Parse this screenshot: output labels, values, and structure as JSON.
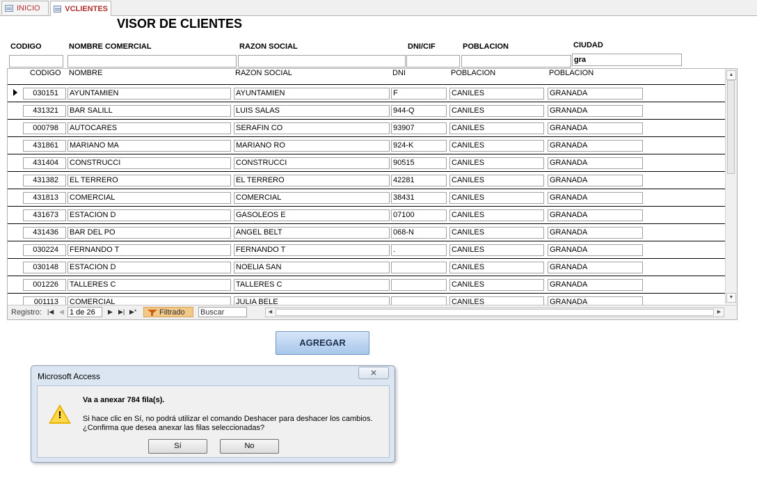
{
  "tabs": [
    {
      "label": "INICIO",
      "icon": "form-icon",
      "active": false
    },
    {
      "label": "VCLIENTES",
      "icon": "form-icon",
      "active": true
    }
  ],
  "page_title": "VISOR DE CLIENTES",
  "filters": {
    "codigo": {
      "label": "CODIGO",
      "value": ""
    },
    "nombre_comercial": {
      "label": "NOMBRE COMERCIAL",
      "value": ""
    },
    "razon_social": {
      "label": "RAZON SOCIAL",
      "value": ""
    },
    "dni_cif": {
      "label": "DNI/CIF",
      "value": ""
    },
    "poblacion": {
      "label": "POBLACION",
      "value": ""
    },
    "ciudad": {
      "label": "CIUDAD",
      "value": "gra"
    }
  },
  "grid": {
    "columns": [
      "CODIGO",
      "NOMBRE",
      "RAZON SOCIAL",
      "DNI",
      "POBLACION",
      "POBLACION"
    ],
    "rows": [
      [
        "030151",
        "AYUNTAMIEN",
        "AYUNTAMIEN",
        "F",
        "CANILES",
        "GRANADA"
      ],
      [
        "431321",
        "BAR SALILL",
        "LUIS SALAS",
        "944-Q",
        "CANILES",
        "GRANADA"
      ],
      [
        "000798",
        "AUTOCARES",
        "SERAFIN CO",
        "93907",
        "CANILES",
        "GRANADA"
      ],
      [
        "431861",
        "MARIANO MA",
        "MARIANO RO",
        "924-K",
        "CANILES",
        "GRANADA"
      ],
      [
        "431404",
        "CONSTRUCCI",
        "CONSTRUCCI",
        "90515",
        "CANILES",
        "GRANADA"
      ],
      [
        "431382",
        "EL TERRERO",
        "EL TERRERO",
        "42281",
        "CANILES",
        "GRANADA"
      ],
      [
        "431813",
        "COMERCIAL",
        "COMERCIAL",
        "38431",
        "CANILES",
        "GRANADA"
      ],
      [
        "431673",
        "ESTACION D",
        "GASOLEOS E",
        "07100",
        "CANILES",
        "GRANADA"
      ],
      [
        "431436",
        "BAR DEL PO",
        "ANGEL BELT",
        "068-N",
        "CANILES",
        "GRANADA"
      ],
      [
        "030224",
        "FERNANDO T",
        "FERNANDO T",
        ".",
        "CANILES",
        "GRANADA"
      ],
      [
        "030148",
        "ESTACION D",
        "NOELIA SAN",
        "",
        "CANILES",
        "GRANADA"
      ],
      [
        "001226",
        "TALLERES C",
        "TALLERES C",
        "",
        "CANILES",
        "GRANADA"
      ],
      [
        "001113",
        "COMERCIAL",
        "JULIA BELE",
        "",
        "CANILES",
        "GRANADA"
      ]
    ]
  },
  "navigator": {
    "label": "Registro:",
    "record": "1 de 26",
    "filter_label": "Filtrado",
    "search_placeholder": "Buscar"
  },
  "add_button": "AGREGAR",
  "dialog": {
    "title": "Microsoft Access",
    "close": "✕",
    "heading": "Va a anexar 784 fila(s).",
    "line1": "Si hace clic en Sí, no podrá utilizar el comando Deshacer para deshacer los cambios.",
    "line2": "¿Confirma que desea anexar las filas seleccionadas?",
    "yes": "Sí",
    "no": "No",
    "icon": "warning-icon"
  }
}
